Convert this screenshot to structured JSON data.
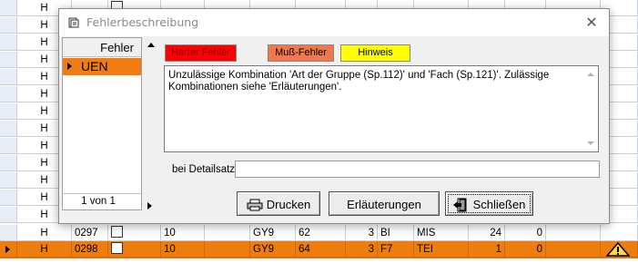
{
  "grid": {
    "rows": [
      {
        "h": "H"
      },
      {
        "h": "H"
      },
      {
        "h": "H"
      },
      {
        "h": "H"
      },
      {
        "h": "H"
      },
      {
        "h": "H"
      },
      {
        "h": "H"
      },
      {
        "h": "H"
      },
      {
        "h": "H"
      },
      {
        "h": "H"
      },
      {
        "h": "H"
      },
      {
        "h": "H"
      },
      {
        "h": "H"
      }
    ],
    "partial_row": {
      "h": "H",
      "num": "0297",
      "class": "10",
      "group": "GY9",
      "c62": "62",
      "c3": "3",
      "bi": "BI",
      "mis": "MIS",
      "v24": "24",
      "v0": "0"
    },
    "selected_row": {
      "h": "H",
      "num": "0298",
      "class": "10",
      "group": "GY9",
      "c64": "64",
      "c3": "3",
      "f7": "F7",
      "tei": "TEI",
      "v1": "1",
      "v0": "0"
    }
  },
  "dialog": {
    "title": "Fehlerbeschreibung",
    "close": "✕",
    "list": {
      "header": "Fehler",
      "items": [
        "UEN"
      ],
      "pager": "1 von 1"
    },
    "legend": {
      "hard": {
        "label": "Harter Fehler",
        "color": "#ff0000"
      },
      "must": {
        "label": "Muß-Fehler",
        "color": "#f0784a"
      },
      "hint": {
        "label": "Hinweis",
        "color": "#ffff00"
      }
    },
    "message": "Unzulässige Kombination 'Art der Gruppe (Sp.112)' und 'Fach (Sp.121)'. Zulässige Kombinationen siehe 'Erläuterungen'.",
    "detail_label": "bei Detailsatz:",
    "detail_value": "",
    "buttons": {
      "print": "Drucken",
      "explain": "Erläuterungen",
      "close": "Schließen"
    }
  },
  "colors": {
    "selected_row": "#ef7d0e",
    "list_selected": "#f07c12"
  }
}
